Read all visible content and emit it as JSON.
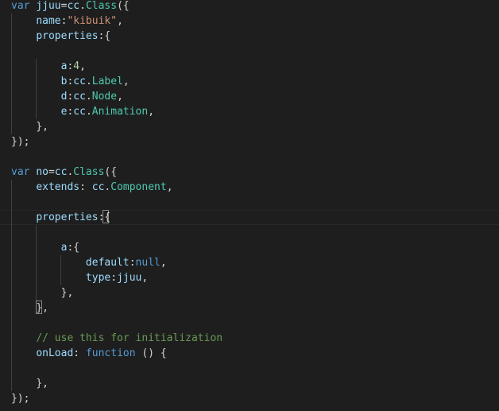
{
  "editor": {
    "colors": {
      "background": "#1e1e1e",
      "keyword": "#569cd6",
      "variable": "#9cdcfe",
      "type": "#4ec9b0",
      "string": "#ce9178",
      "number": "#b5cea8",
      "comment": "#6a9955",
      "punctuation": "#d4d4d4",
      "indent_guide": "#404040"
    },
    "lines": [
      [
        {
          "t": "var",
          "c": "kw"
        },
        {
          "t": " ",
          "c": "punc"
        },
        {
          "t": "jjuu",
          "c": "var"
        },
        {
          "t": "=",
          "c": "punc"
        },
        {
          "t": "cc",
          "c": "var"
        },
        {
          "t": ".",
          "c": "punc"
        },
        {
          "t": "Class",
          "c": "type"
        },
        {
          "t": "({",
          "c": "punc"
        }
      ],
      [
        {
          "t": "    ",
          "c": "punc"
        },
        {
          "t": "name",
          "c": "prop"
        },
        {
          "t": ":",
          "c": "punc"
        },
        {
          "t": "\"kibuik\"",
          "c": "str"
        },
        {
          "t": ",",
          "c": "punc"
        }
      ],
      [
        {
          "t": "    ",
          "c": "punc"
        },
        {
          "t": "properties",
          "c": "prop"
        },
        {
          "t": ":{",
          "c": "punc"
        }
      ],
      [],
      [
        {
          "t": "        ",
          "c": "punc"
        },
        {
          "t": "a",
          "c": "prop"
        },
        {
          "t": ":",
          "c": "punc"
        },
        {
          "t": "4",
          "c": "num"
        },
        {
          "t": ",",
          "c": "punc"
        }
      ],
      [
        {
          "t": "        ",
          "c": "punc"
        },
        {
          "t": "b",
          "c": "prop"
        },
        {
          "t": ":",
          "c": "punc"
        },
        {
          "t": "cc",
          "c": "var"
        },
        {
          "t": ".",
          "c": "punc"
        },
        {
          "t": "Label",
          "c": "type"
        },
        {
          "t": ",",
          "c": "punc"
        }
      ],
      [
        {
          "t": "        ",
          "c": "punc"
        },
        {
          "t": "d",
          "c": "prop"
        },
        {
          "t": ":",
          "c": "punc"
        },
        {
          "t": "cc",
          "c": "var"
        },
        {
          "t": ".",
          "c": "punc"
        },
        {
          "t": "Node",
          "c": "type"
        },
        {
          "t": ",",
          "c": "punc"
        }
      ],
      [
        {
          "t": "        ",
          "c": "punc"
        },
        {
          "t": "e",
          "c": "prop"
        },
        {
          "t": ":",
          "c": "punc"
        },
        {
          "t": "cc",
          "c": "var"
        },
        {
          "t": ".",
          "c": "punc"
        },
        {
          "t": "Animation",
          "c": "type"
        },
        {
          "t": ",",
          "c": "punc"
        }
      ],
      [
        {
          "t": "    ",
          "c": "punc"
        },
        {
          "t": "},",
          "c": "punc"
        }
      ],
      [
        {
          "t": "});",
          "c": "punc"
        }
      ],
      [],
      [
        {
          "t": "var",
          "c": "kw"
        },
        {
          "t": " ",
          "c": "punc"
        },
        {
          "t": "no",
          "c": "var"
        },
        {
          "t": "=",
          "c": "punc"
        },
        {
          "t": "cc",
          "c": "var"
        },
        {
          "t": ".",
          "c": "punc"
        },
        {
          "t": "Class",
          "c": "type"
        },
        {
          "t": "({",
          "c": "punc"
        }
      ],
      [
        {
          "t": "    ",
          "c": "punc"
        },
        {
          "t": "extends",
          "c": "prop"
        },
        {
          "t": ": ",
          "c": "punc"
        },
        {
          "t": "cc",
          "c": "var"
        },
        {
          "t": ".",
          "c": "punc"
        },
        {
          "t": "Component",
          "c": "type"
        },
        {
          "t": ",",
          "c": "punc"
        }
      ],
      [],
      [
        {
          "t": "    ",
          "c": "punc"
        },
        {
          "t": "properties",
          "c": "prop"
        },
        {
          "t": ":{",
          "c": "punc"
        }
      ],
      [],
      [
        {
          "t": "        ",
          "c": "punc"
        },
        {
          "t": "a",
          "c": "prop"
        },
        {
          "t": ":{",
          "c": "punc"
        }
      ],
      [
        {
          "t": "            ",
          "c": "punc"
        },
        {
          "t": "default",
          "c": "prop"
        },
        {
          "t": ":",
          "c": "punc"
        },
        {
          "t": "null",
          "c": "kw"
        },
        {
          "t": ",",
          "c": "punc"
        }
      ],
      [
        {
          "t": "            ",
          "c": "punc"
        },
        {
          "t": "type",
          "c": "prop"
        },
        {
          "t": ":",
          "c": "punc"
        },
        {
          "t": "jjuu",
          "c": "var"
        },
        {
          "t": ",",
          "c": "punc"
        }
      ],
      [
        {
          "t": "        ",
          "c": "punc"
        },
        {
          "t": "},",
          "c": "punc"
        }
      ],
      [
        {
          "t": "    ",
          "c": "punc"
        },
        {
          "t": "},",
          "c": "punc"
        }
      ],
      [],
      [
        {
          "t": "    ",
          "c": "punc"
        },
        {
          "t": "// use this for initialization",
          "c": "comment"
        }
      ],
      [
        {
          "t": "    ",
          "c": "punc"
        },
        {
          "t": "onLoad",
          "c": "prop"
        },
        {
          "t": ": ",
          "c": "punc"
        },
        {
          "t": "function",
          "c": "kw"
        },
        {
          "t": " () {",
          "c": "punc"
        }
      ],
      [],
      [
        {
          "t": "    ",
          "c": "punc"
        },
        {
          "t": "},",
          "c": "punc"
        }
      ],
      [
        {
          "t": "});",
          "c": "punc"
        }
      ]
    ]
  }
}
